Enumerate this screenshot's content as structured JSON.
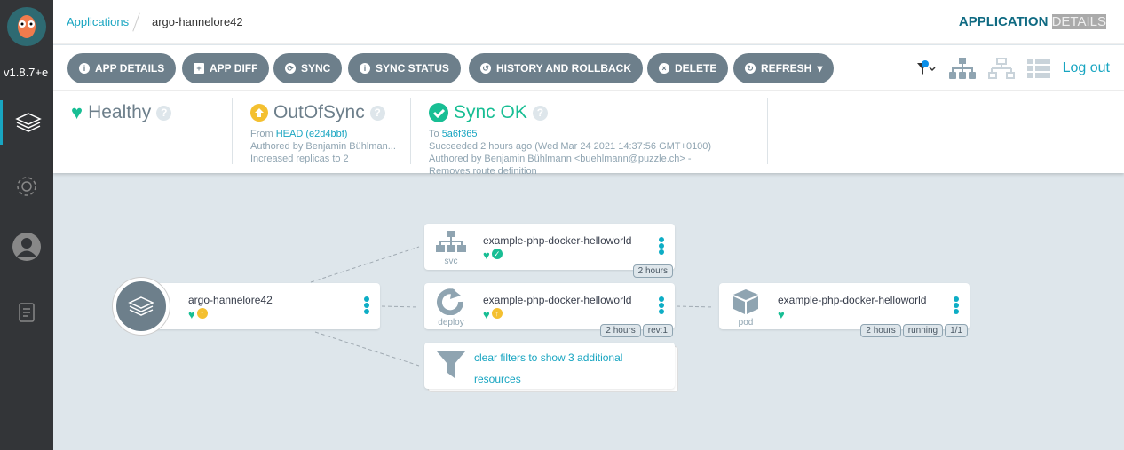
{
  "sidebar": {
    "version": "v1.8.7+e",
    "items": [
      {
        "icon": "layers-icon",
        "active": true
      },
      {
        "icon": "gear-icon"
      },
      {
        "icon": "user-icon"
      },
      {
        "icon": "docs-icon"
      }
    ]
  },
  "header": {
    "breadcrumb_root": "Applications",
    "breadcrumb_current": "argo-hannelore42",
    "title_a": "APPLICATION",
    "title_b": "DETAILS"
  },
  "toolbar": {
    "buttons": [
      "APP DETAILS",
      "APP DIFF",
      "SYNC",
      "SYNC STATUS",
      "HISTORY AND ROLLBACK",
      "DELETE",
      "REFRESH"
    ],
    "logout": "Log out"
  },
  "status": {
    "health": {
      "label": "Healthy",
      "color": "#18be94"
    },
    "sync": {
      "label": "OutOfSync",
      "from": "From",
      "revision": "HEAD (e2d4bbf)",
      "author": "Authored by Benjamin Bühlman...",
      "message": "Increased replicas to 2",
      "color": "#f4c030"
    },
    "operation": {
      "label": "Sync OK",
      "to": "To",
      "revision": "5a6f365",
      "succeeded": "Succeeded 2 hours ago (Wed Mar 24 2021 14:37:56 GMT+0100)",
      "author": "Authored by Benjamin Bühlmann <buehlmann@puzzle.ch> -",
      "message": "Removes route definition"
    }
  },
  "graph": {
    "app": {
      "name": "argo-hannelore42"
    },
    "svc": {
      "name": "example-php-docker-helloworld",
      "kind": "svc",
      "tags": [
        "2 hours"
      ]
    },
    "deploy": {
      "name": "example-php-docker-helloworld",
      "kind": "deploy",
      "tags": [
        "2 hours",
        "rev:1"
      ]
    },
    "filter": {
      "text": "clear filters to show 3 additional resources"
    },
    "pod": {
      "name": "example-php-docker-helloworld",
      "kind": "pod",
      "tags": [
        "2 hours",
        "running",
        "1/1"
      ]
    }
  }
}
